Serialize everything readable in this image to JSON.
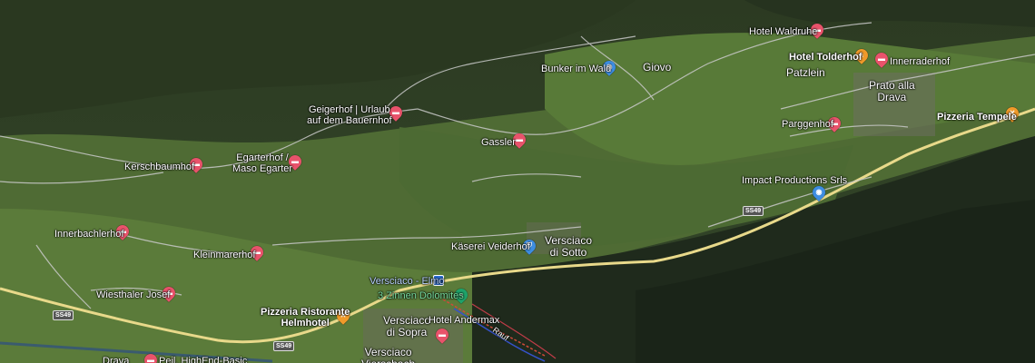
{
  "places": {
    "hotel_waldruhe": "Hotel Waldruhe",
    "hotel_tolderhof": "Hotel Tolderhof",
    "innerraderhof": "Innerraderhof",
    "patzlein": "Patzlein",
    "prato_alla_drava": "Prato alla\nDrava",
    "pizzeria_tempele": "Pizzeria Tempele",
    "bunker_im_wald": "Bunker im Wald",
    "giovo": "Giovo",
    "parggenhof": "Parggenhof",
    "geigerhof": "Geigerhof | Urlaub\nauf dem Bauernhof",
    "gassler": "Gassler",
    "impact_productions": "Impact Productions Srls",
    "kerschbaumhof": "Kerschbaumhof",
    "egarterhof": "Egarterhof /\nMaso Egarter",
    "innerbachlerhof": "Innerbachlerhof",
    "kaeserei_veiderhof": "Käserei Veiderhof",
    "versciaco_di_sotto": "Versciaco\ndi Sotto",
    "kleinmarerhof": "Kleinmarerhof",
    "versciaco_elmo": "Versciaco - Elmo",
    "tre_zinnen": "3 Zinnen Dolomites",
    "wiesthaler_josef": "Wiesthaler Josef",
    "pizzeria_helmhotel": "Pizzeria Ristorante\nHelmhotel",
    "versciaco_di_sopra": "Versciaco\ndi Sopra",
    "hotel_andermax": "Hotel Andermax",
    "versciaco_vierschach": "Versciaco\nVierschach",
    "drava": "Drava",
    "peil": "Peil. HighEnd-Basic"
  },
  "roads": {
    "ss49_a": "SS49",
    "ss49_b": "SS49",
    "ss49_c": "SS49"
  },
  "lift_label": "Rauf"
}
